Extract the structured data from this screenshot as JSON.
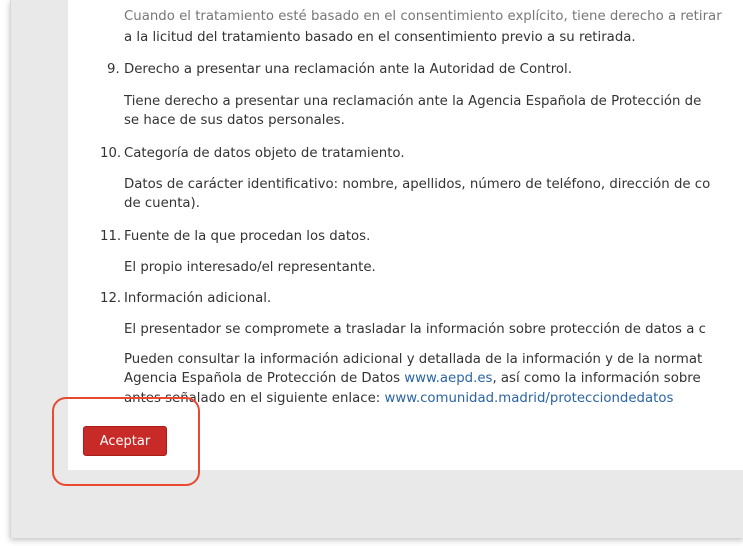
{
  "content": {
    "partial_top": "Cuando el tratamiento esté basado en el consentimiento explícito, tiene derecho a retirar",
    "withdraw_line": "a la licitud del tratamiento basado en el consentimiento previo a su retirada.",
    "items": [
      {
        "number": "9.",
        "heading": "Derecho a presentar una reclamación ante la Autoridad de Control.",
        "paragraphs": [
          [
            "Tiene derecho a presentar una reclamación ante la Agencia Española de Protección de",
            "se hace de sus datos personales."
          ]
        ]
      },
      {
        "number": "10.",
        "heading": "Categoría de datos objeto de tratamiento.",
        "paragraphs": [
          [
            "Datos de carácter identificativo: nombre, apellidos, número de teléfono, dirección de co",
            "de cuenta)."
          ]
        ]
      },
      {
        "number": "11.",
        "heading": "Fuente de la que procedan los datos.",
        "paragraphs": [
          [
            "El propio interesado/el representante."
          ]
        ]
      },
      {
        "number": "12.",
        "heading": "Información adicional.",
        "paragraphs": [
          [
            "El presentador se compromete a trasladar la información sobre protección de datos a c"
          ]
        ]
      }
    ],
    "additional": {
      "line1": "Pueden consultar la información adicional y detallada de la información y de la normat",
      "line2_prefix": "Agencia Española de Protección de Datos ",
      "link_aepd": "www.aepd.es",
      "line2_suffix": ", así como la información sobre",
      "line3_prefix": "antes señalado en el siguiente enlace: ",
      "link_madrid": "www.comunidad.madrid/protecciondedatos"
    }
  },
  "actions": {
    "accept_label": "Aceptar"
  },
  "colors": {
    "accept_button": "#c72a27",
    "link": "#2a64a4",
    "highlight": "#e8492f"
  }
}
